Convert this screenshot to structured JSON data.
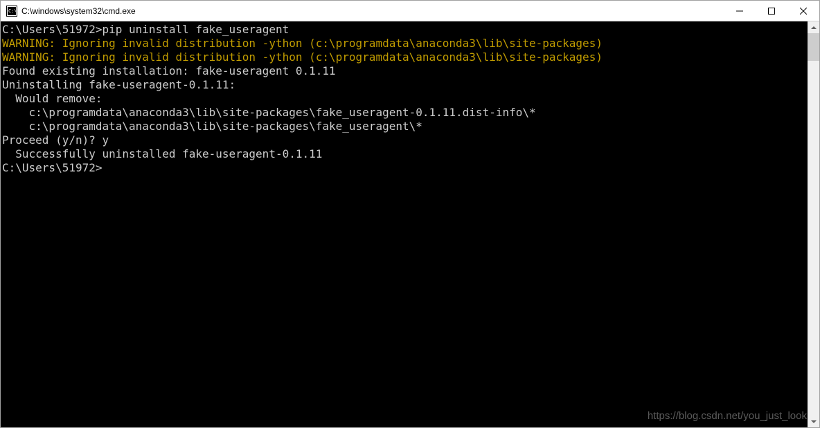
{
  "window": {
    "title": "C:\\windows\\system32\\cmd.exe"
  },
  "terminal": {
    "line1_prompt": "C:\\Users\\51972>",
    "line1_cmd": "pip uninstall fake_useragent",
    "warn1": "WARNING: Ignoring invalid distribution -ython (c:\\programdata\\anaconda3\\lib\\site-packages)",
    "warn2": "WARNING: Ignoring invalid distribution -ython (c:\\programdata\\anaconda3\\lib\\site-packages)",
    "found": "Found existing installation: fake-useragent 0.1.11",
    "uninstalling": "Uninstalling fake-useragent-0.1.11:",
    "would_remove": "  Would remove:",
    "path1": "    c:\\programdata\\anaconda3\\lib\\site-packages\\fake_useragent-0.1.11.dist-info\\*",
    "path2": "    c:\\programdata\\anaconda3\\lib\\site-packages\\fake_useragent\\*",
    "proceed": "Proceed (y/n)? y",
    "success": "  Successfully uninstalled fake-useragent-0.1.11",
    "blank": "",
    "prompt2": "C:\\Users\\51972>"
  },
  "watermark": "https://blog.csdn.net/you_just_look"
}
